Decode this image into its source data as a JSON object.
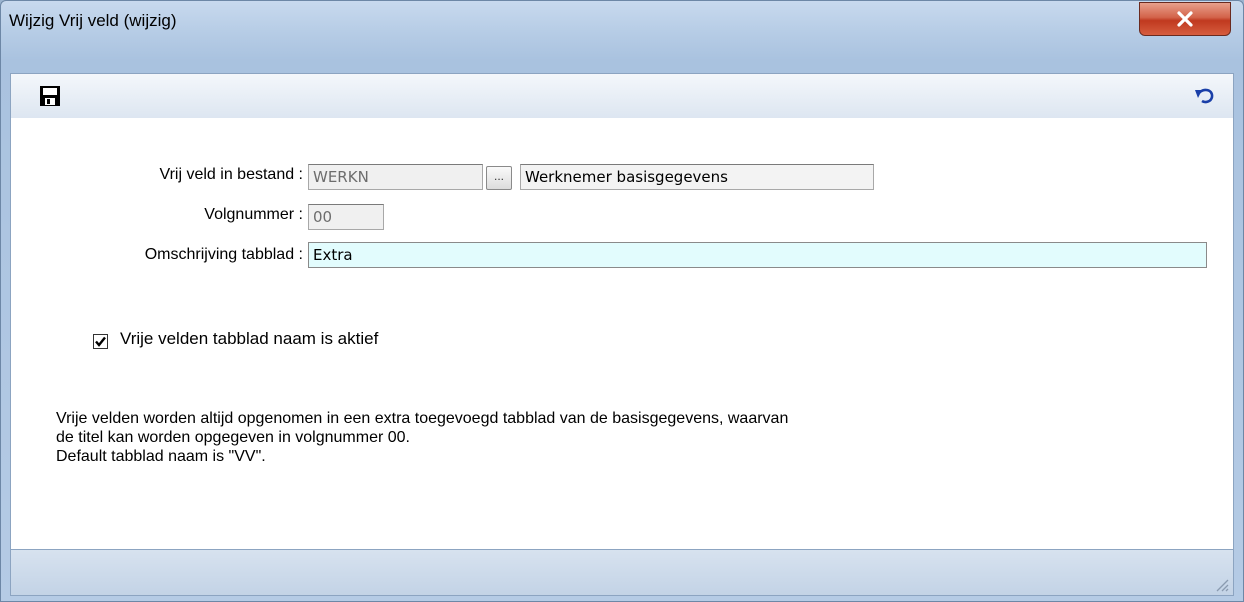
{
  "window": {
    "title": "Wijzig Vrij veld  (wijzig)",
    "close_label": "x"
  },
  "toolbar": {
    "save_icon": "floppy-disk-icon",
    "undo_icon": "undo-arrow-icon"
  },
  "form": {
    "file_label": "Vrij veld in bestand :",
    "file_code": "WERKN",
    "lookup_label": "...",
    "file_description": "Werknemer basisgegevens",
    "seq_label": "Volgnummer :",
    "seq_value": "00",
    "tab_desc_label": "Omschrijving tabblad :",
    "tab_desc_value": "Extra",
    "checkbox_label": "Vrije velden tabblad naam is aktief",
    "checkbox_checked": true
  },
  "info": {
    "line1": "Vrije velden worden altijd opgenomen in een extra toegevoegd tabblad van de basisgegevens, waarvan",
    "line2": "de titel kan worden opgegeven in volgnummer 00.",
    "line3": "Default tabblad naam is \"VV\"."
  }
}
